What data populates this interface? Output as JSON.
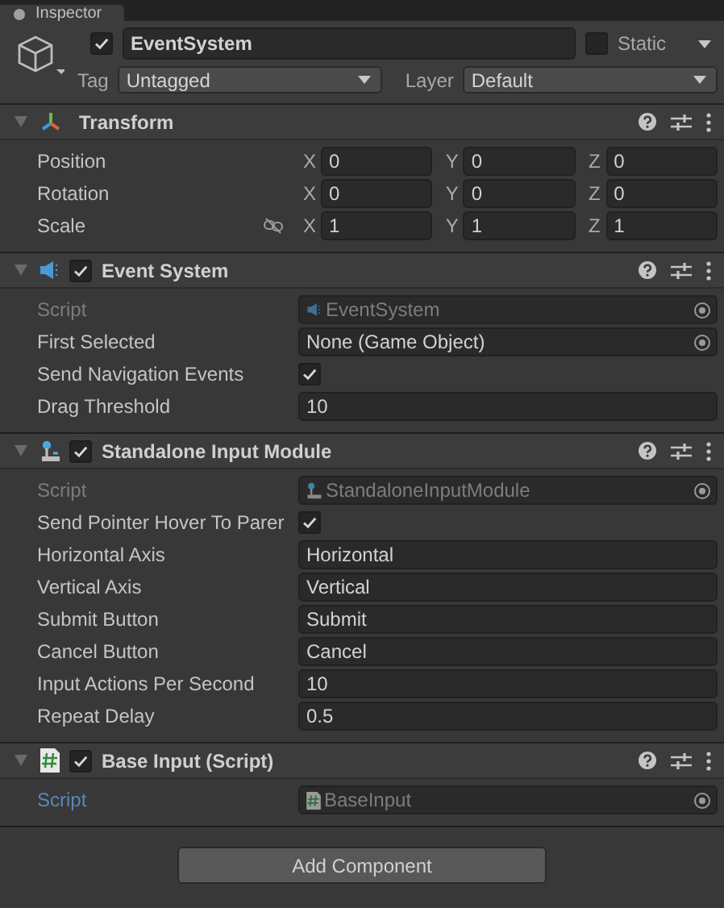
{
  "tab": {
    "label": "Inspector",
    "selected": true
  },
  "object": {
    "active": true,
    "name": "EventSystem",
    "static": false,
    "static_label": "Static",
    "tag_label": "Tag",
    "tag": "Untagged",
    "layer_label": "Layer",
    "layer": "Default"
  },
  "components": [
    {
      "kind": "transform",
      "title": "Transform",
      "expanded": true,
      "rows": [
        {
          "kind": "vector",
          "label": "Position",
          "values": [
            {
              "axis": "X",
              "value": "0"
            },
            {
              "axis": "Y",
              "value": "0"
            },
            {
              "axis": "Z",
              "value": "0"
            }
          ]
        },
        {
          "kind": "vector",
          "label": "Rotation",
          "values": [
            {
              "axis": "X",
              "value": "0"
            },
            {
              "axis": "Y",
              "value": "0"
            },
            {
              "axis": "Z",
              "value": "0"
            }
          ]
        },
        {
          "kind": "vector",
          "label": "Scale",
          "linked": false,
          "values": [
            {
              "axis": "X",
              "value": "1"
            },
            {
              "axis": "Y",
              "value": "1"
            },
            {
              "axis": "Z",
              "value": "1"
            }
          ]
        }
      ]
    },
    {
      "kind": "event",
      "title": "Event System",
      "enabled": true,
      "expanded": true,
      "rows": [
        {
          "kind": "script",
          "label": "Script",
          "value": "EventSystem",
          "highlighted": false
        },
        {
          "kind": "object",
          "label": "First Selected",
          "value": "None (Game Object)"
        },
        {
          "kind": "toggle",
          "label": "Send Navigation Events",
          "checked": true
        },
        {
          "kind": "text",
          "label": "Drag Threshold",
          "value": "10"
        }
      ]
    },
    {
      "kind": "input",
      "title": "Standalone Input Module",
      "enabled": true,
      "expanded": true,
      "rows": [
        {
          "kind": "script",
          "label": "Script",
          "value": "StandaloneInputModule",
          "highlighted": false
        },
        {
          "kind": "toggle",
          "label": "Send Pointer Hover To Parer",
          "checked": true
        },
        {
          "kind": "text",
          "label": "Horizontal Axis",
          "value": "Horizontal"
        },
        {
          "kind": "text",
          "label": "Vertical Axis",
          "value": "Vertical"
        },
        {
          "kind": "text",
          "label": "Submit Button",
          "value": "Submit"
        },
        {
          "kind": "text",
          "label": "Cancel Button",
          "value": "Cancel"
        },
        {
          "kind": "text",
          "label": "Input Actions Per Second",
          "value": "10"
        },
        {
          "kind": "text",
          "label": "Repeat Delay",
          "value": "0.5"
        }
      ]
    },
    {
      "kind": "script",
      "title": "Base Input (Script)",
      "enabled": true,
      "expanded": true,
      "rows": [
        {
          "kind": "script",
          "label": "Script",
          "value": "BaseInput",
          "highlighted": true
        }
      ]
    }
  ],
  "add_button": {
    "label": "Add Component"
  }
}
